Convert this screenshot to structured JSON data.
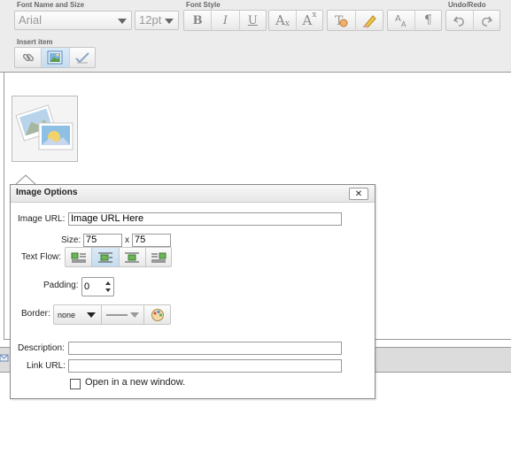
{
  "toolbar": {
    "font_group_label": "Font Name and Size",
    "font_name": "Arial",
    "font_size": "12pt",
    "style_group_label": "Font Style",
    "bold": "B",
    "italic": "I",
    "underline": "U",
    "subscript": "A",
    "subscript_sub": "x",
    "superscript": "A",
    "superscript_sup": "x",
    "undo_group_label": "Undo/Redo",
    "insert_group_label": "Insert item",
    "paragraph_mark": "¶"
  },
  "image_options": {
    "title": "Image Options",
    "close": "✕",
    "url_label": "Image URL:",
    "url_value": "Image URL Here",
    "size_label": "Size:",
    "width": "75",
    "times": "x",
    "height": "75",
    "text_flow_label": "Text Flow:",
    "padding_label": "Padding:",
    "padding_value": "0",
    "border_label": "Border:",
    "border_style": "none",
    "description_label": "Description:",
    "description_value": "",
    "link_label": "Link URL:",
    "link_value": "",
    "new_window_label": "Open in a new window."
  },
  "colors": {
    "toolbar_bg": "#ececec",
    "active_button": "#c6dcef",
    "dialog_border": "#8a8a8a"
  }
}
